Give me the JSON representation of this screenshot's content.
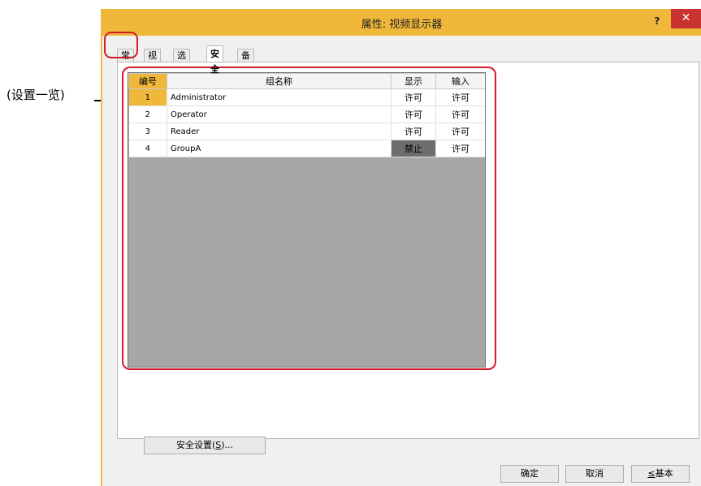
{
  "callout": {
    "label": "(设置一览)"
  },
  "window": {
    "title": "属性: 视频显示器",
    "help_label": "?",
    "close_label": "✕"
  },
  "tabs": [
    {
      "label": "常规"
    },
    {
      "label": "视图"
    },
    {
      "label": "选项"
    },
    {
      "label": "安全"
    },
    {
      "label": "备注"
    }
  ],
  "active_tab": "安全",
  "table": {
    "headers": {
      "num": "编号",
      "group": "组名称",
      "display": "显示",
      "input": "输入"
    },
    "rows": [
      {
        "num": "1",
        "group": "Administrator",
        "display": "许可",
        "input": "许可"
      },
      {
        "num": "2",
        "group": "Operator",
        "display": "许可",
        "input": "许可"
      },
      {
        "num": "3",
        "group": "Reader",
        "display": "许可",
        "input": "许可"
      },
      {
        "num": "4",
        "group": "GroupA",
        "display": "禁止",
        "input": "许可"
      }
    ]
  },
  "buttons": {
    "security_prefix": "安全设置(",
    "security_key": "S",
    "security_suffix": ")...",
    "ok": "确定",
    "cancel": "取消",
    "basic_key": "≤",
    "basic_label": "基本"
  },
  "colors": {
    "accent": "#f0b83a",
    "highlight": "#d41a2d",
    "close": "#c8332f",
    "grid_empty": "#a7a7a7",
    "denied_cell": "#6e6e6e"
  }
}
